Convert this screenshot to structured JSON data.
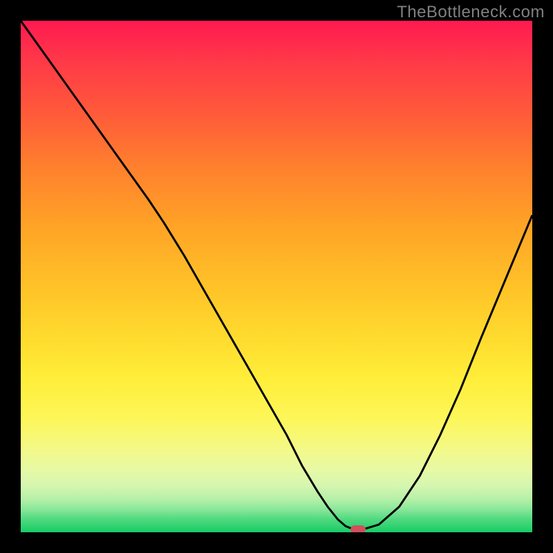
{
  "watermark": "TheBottleneck.com",
  "colors": {
    "frame": "#000000",
    "curve": "#000000",
    "marker": "#d0505c"
  },
  "chart_data": {
    "type": "line",
    "title": "",
    "xlabel": "",
    "ylabel": "",
    "xlim": [
      0,
      100
    ],
    "ylim": [
      0,
      100
    ],
    "x": [
      0,
      5,
      10,
      15,
      20,
      25,
      28,
      32,
      36,
      40,
      44,
      48,
      52,
      55,
      58,
      60,
      62,
      63.5,
      65,
      67,
      70,
      74,
      78,
      82,
      86,
      90,
      95,
      100
    ],
    "y": [
      100,
      93,
      86,
      79,
      72,
      65,
      60.5,
      54,
      47,
      40,
      33,
      26,
      19,
      13,
      8,
      5,
      2.5,
      1.2,
      0.6,
      0.6,
      1.5,
      5,
      11,
      19,
      28,
      38,
      50,
      62
    ],
    "marker": {
      "x": 66,
      "y": 0.6
    },
    "grid": false,
    "legend": null
  }
}
